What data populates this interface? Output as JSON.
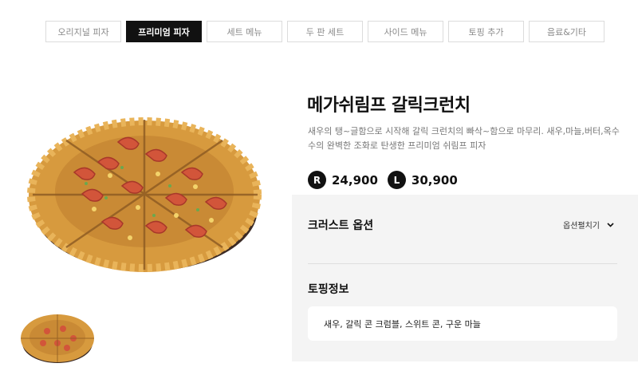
{
  "tabs": [
    {
      "label": "오리지널 피자",
      "active": false
    },
    {
      "label": "프리미엄 피자",
      "active": true
    },
    {
      "label": "세트 메뉴",
      "active": false
    },
    {
      "label": "두 판 세트",
      "active": false
    },
    {
      "label": "사이드 메뉴",
      "active": false
    },
    {
      "label": "토핑 추가",
      "active": false
    },
    {
      "label": "음료&기타",
      "active": false
    }
  ],
  "product": {
    "title": "메가쉬림프 갈릭크런치",
    "description": "새우의 탱~글함으로 시작해 갈릭 크런치의 빠삭~함으로 마무리. 새우,마늘,버터,옥수수의 완벽한 조화로 탄생한 프리미엄 쉬림프 피자",
    "prices": [
      {
        "size": "R",
        "price": "24,900"
      },
      {
        "size": "L",
        "price": "30,900"
      }
    ]
  },
  "options": {
    "crust_title": "크러스트 옵션",
    "expand_label": "옵션펼치기",
    "topping_title": "토핑정보",
    "topping_info": "새우, 갈릭 콘 크럼블, 스위트 콘, 구운 마늘"
  },
  "colors": {
    "active_tab_bg": "#111111",
    "panel_bg": "#f4f4f4",
    "crust": "#d79a3e",
    "shrimp": "#d2553a"
  },
  "icons": {
    "expand": "chevron-down-icon"
  }
}
